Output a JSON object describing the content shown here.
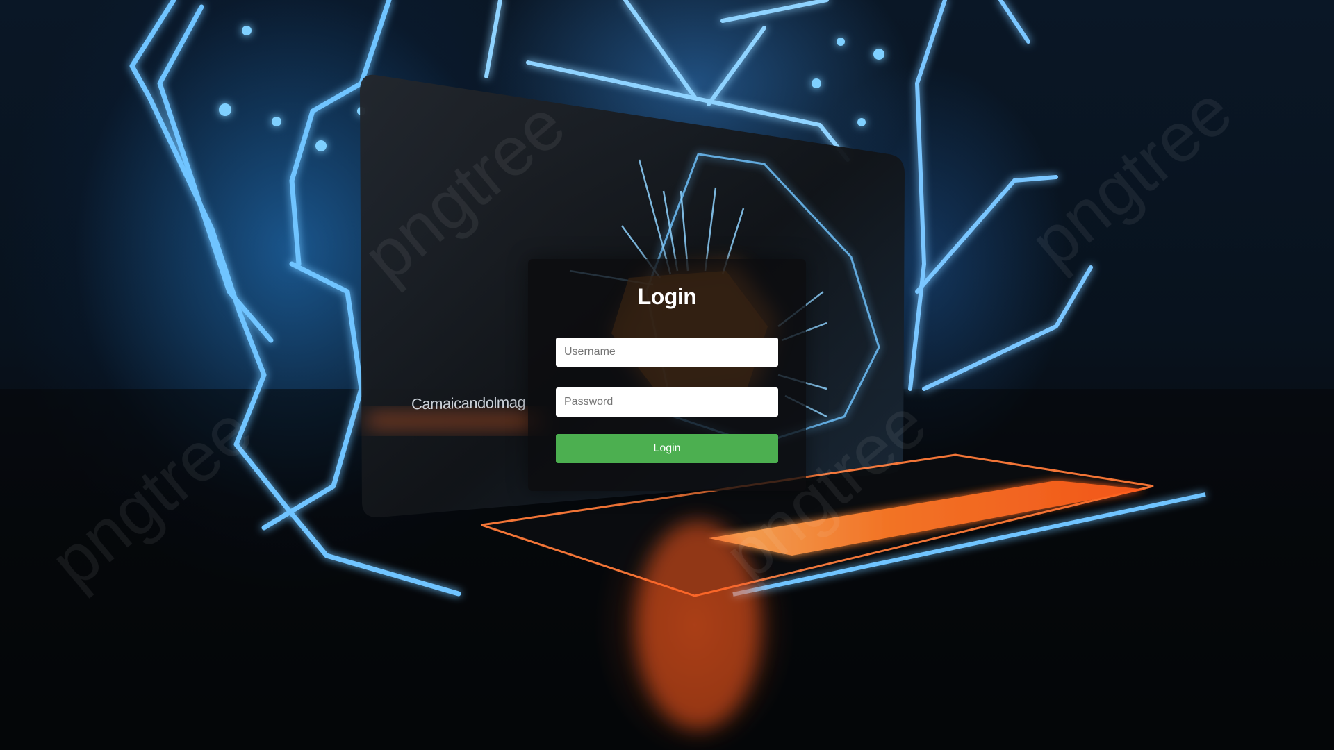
{
  "background": {
    "caption": "Camaicandolmag",
    "watermark": "pngtree"
  },
  "login": {
    "title": "Login",
    "username_placeholder": "Username",
    "password_placeholder": "Password",
    "button_label": "Login"
  },
  "colors": {
    "button": "#4caf50",
    "glow_blue": "#3aa6ff",
    "glow_orange": "#ff6a2a",
    "card": "#0c0c0e"
  }
}
